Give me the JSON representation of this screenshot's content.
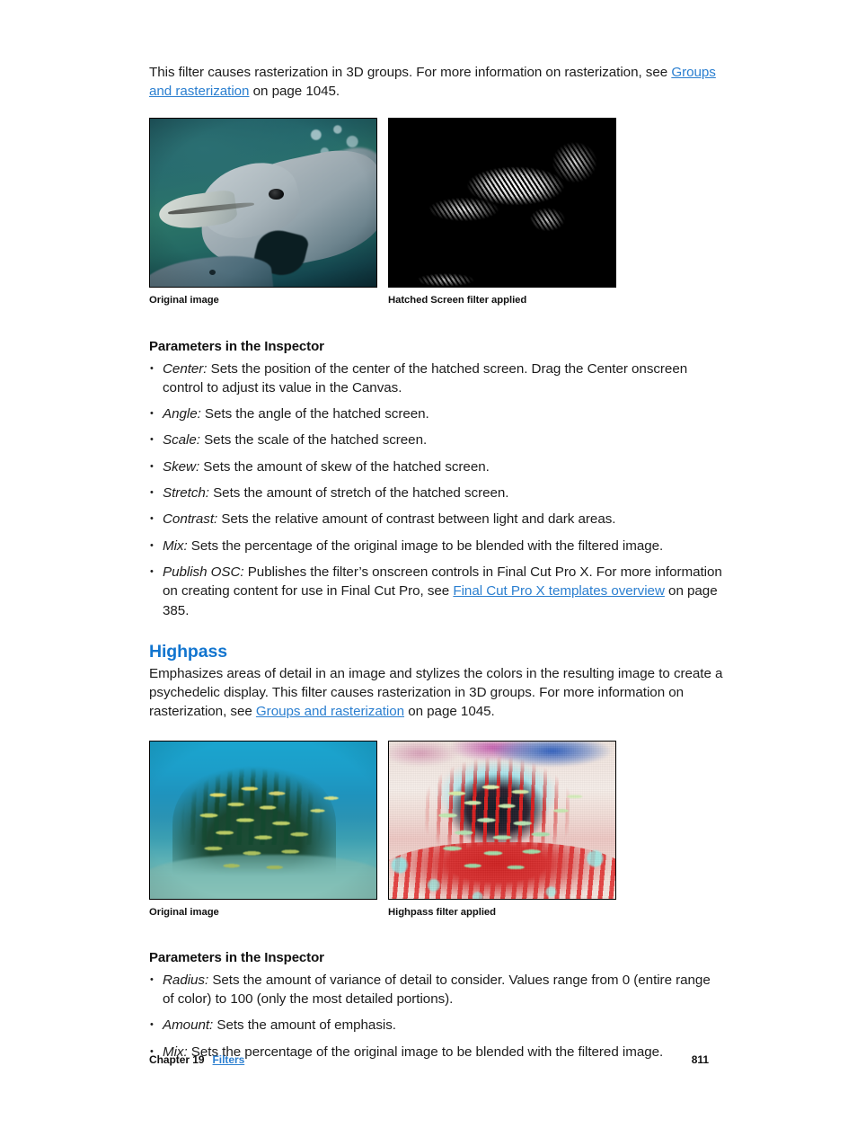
{
  "intro": {
    "text_before_link": "This filter causes rasterization in 3D groups. For more information on rasterization, see ",
    "link_text": "Groups and rasterization",
    "text_after_link": " on page 1045."
  },
  "figures_hatched": {
    "left_caption": "Original image",
    "right_caption": "Hatched Screen filter applied",
    "left_alt": "original-dolphin-photo",
    "right_alt": "hatched-screen-filtered-dolphin"
  },
  "hatched_params": {
    "heading": "Parameters in the Inspector",
    "items": [
      {
        "term": "Center:",
        "desc": " Sets the position of the center of the hatched screen. Drag the Center onscreen control to adjust its value in the Canvas."
      },
      {
        "term": "Angle:",
        "desc": " Sets the angle of the hatched screen."
      },
      {
        "term": "Scale:",
        "desc": " Sets the scale of the hatched screen."
      },
      {
        "term": "Skew:",
        "desc": " Sets the amount of skew of the hatched screen."
      },
      {
        "term": "Stretch:",
        "desc": " Sets the amount of stretch of the hatched screen."
      },
      {
        "term": "Contrast:",
        "desc": " Sets the relative amount of contrast between light and dark areas."
      },
      {
        "term": "Mix:",
        "desc": " Sets the percentage of the original image to be blended with the filtered image."
      },
      {
        "term": "Publish OSC:",
        "desc": " Publishes the filter’s onscreen controls in Final Cut Pro X. For more information on creating content for use in Final Cut Pro, see ",
        "link_text": "Final Cut Pro X templates overview",
        "desc_after_link": " on page 385."
      }
    ]
  },
  "highpass": {
    "heading": "Highpass",
    "body_before_link": "Emphasizes areas of detail in an image and stylizes the colors in the resulting image to create a psychedelic display. This filter causes rasterization in 3D groups. For more information on rasterization, see ",
    "body_link_text": "Groups and rasterization",
    "body_after_link": " on page 1045."
  },
  "figures_highpass": {
    "left_caption": "Original image",
    "right_caption": "Highpass filter applied",
    "left_alt": "original-reef-fish-photo",
    "right_alt": "highpass-filtered-reef-fish"
  },
  "highpass_params": {
    "heading": "Parameters in the Inspector",
    "items": [
      {
        "term": "Radius:",
        "desc": " Sets the amount of variance of detail to consider. Values range from 0 (entire range of color) to 100 (only the most detailed portions)."
      },
      {
        "term": "Amount:",
        "desc": " Sets the amount of emphasis."
      },
      {
        "term": "Mix:",
        "desc": " Sets the percentage of the original image to be blended with the filtered image."
      }
    ]
  },
  "footer": {
    "chapter": "Chapter 19",
    "chapter_link": "Filters",
    "page_number": "811"
  },
  "colors": {
    "link": "#2b7fd0",
    "heading": "#1275cf",
    "text": "#1c1c1c",
    "background": "#ffffff"
  }
}
